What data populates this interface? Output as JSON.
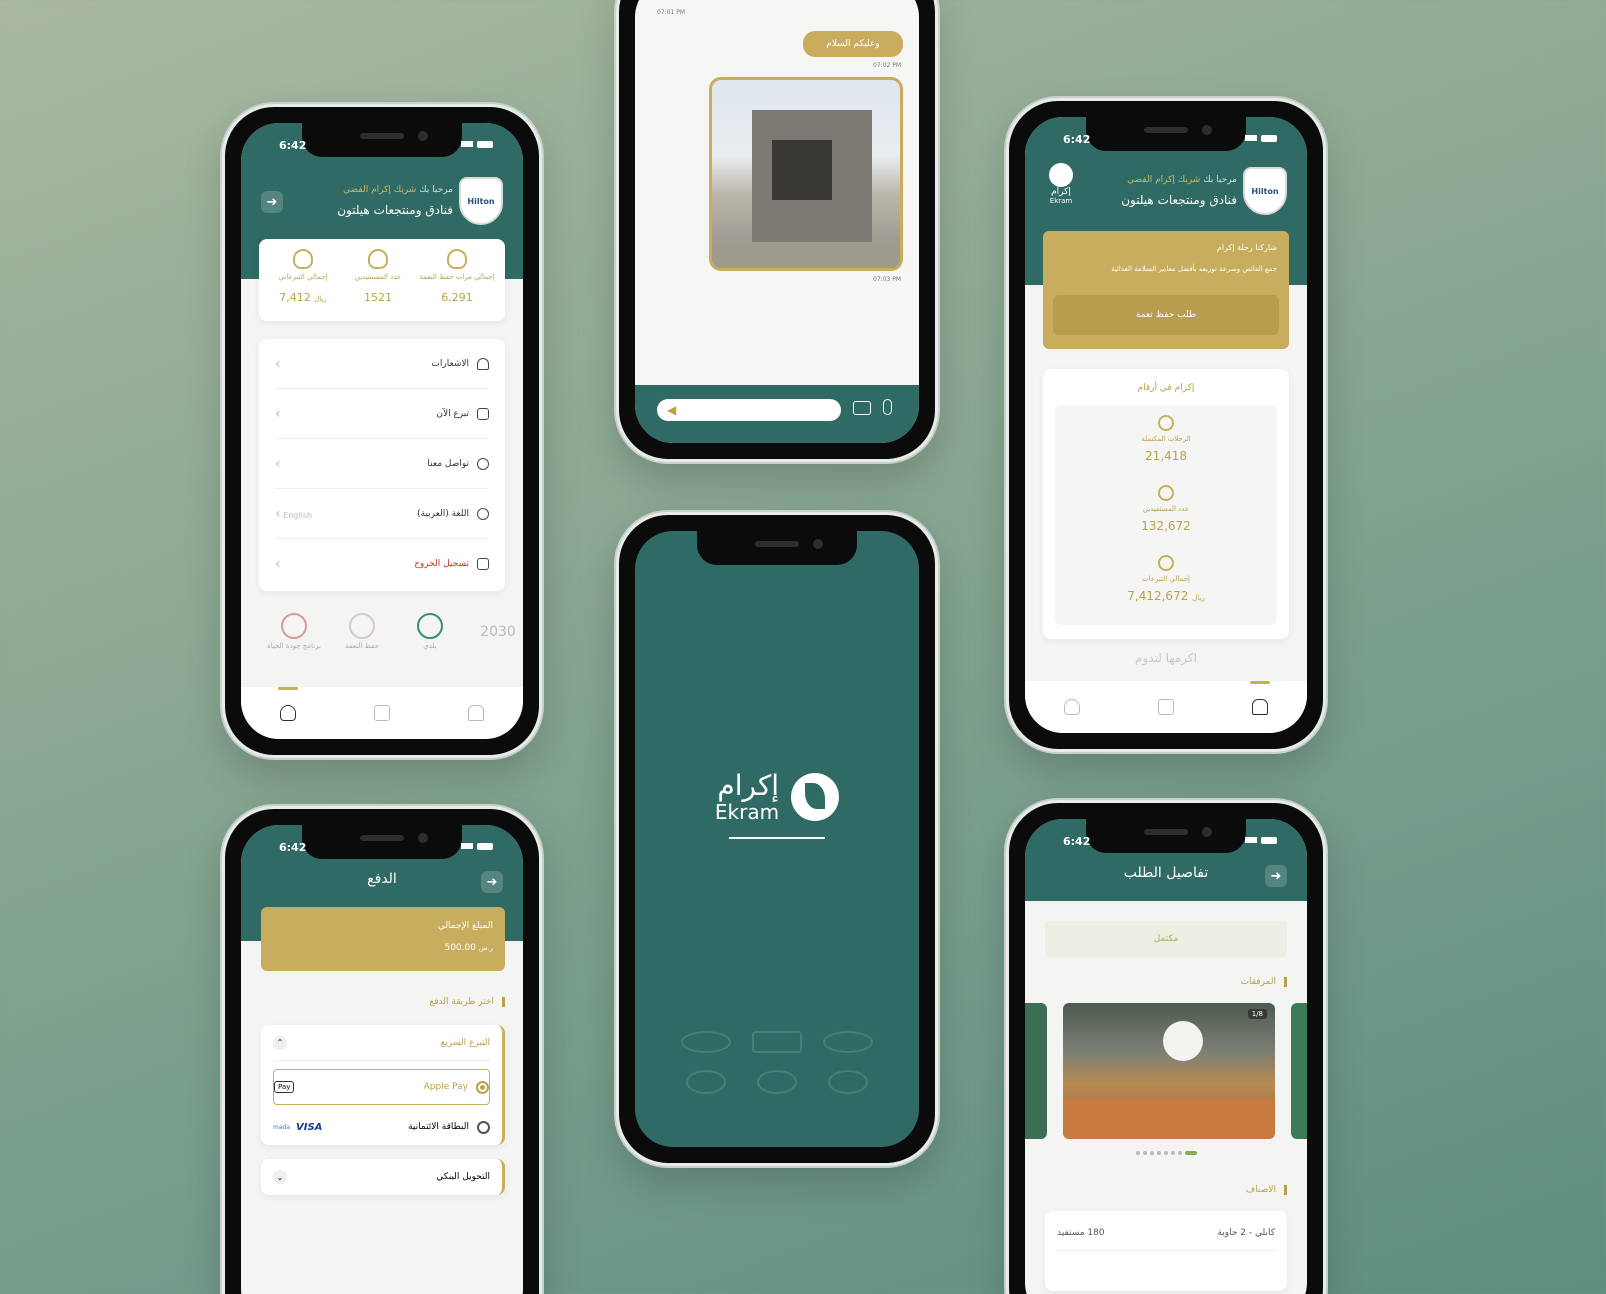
{
  "profile": {
    "time": "6:42",
    "welcome_prefix": "مرحبا بك",
    "partner_badge": "شريك إكرام الفضي",
    "org_name": "فنادق ومنتجعات هيلتون",
    "hilton_label": "Hilton",
    "stats": [
      {
        "label": "إجمالي التبرعاتي",
        "value": "7,412",
        "unit": "ريال"
      },
      {
        "label": "عدد المستفيدين",
        "value": "1521"
      },
      {
        "label": "إجمالي مرات حفظ النعمة",
        "value": "6,291"
      }
    ],
    "menu": [
      {
        "label": "الاشعارات",
        "icon": "bell-icon"
      },
      {
        "label": "تبرع الآن",
        "icon": "donate-icon"
      },
      {
        "label": "تواصل معنا",
        "icon": "headset-icon"
      },
      {
        "label": "اللغة (العربية)",
        "icon": "globe-icon",
        "side": "English"
      },
      {
        "label": "تسجيل الخروج",
        "icon": "logout-icon",
        "danger": true
      }
    ],
    "logos": [
      "برنامج جودة الحياة",
      "حفظ النعمة",
      "بلدي",
      "2030"
    ]
  },
  "chat": {
    "ts1": "07:01 PM",
    "message": "وعليكم السلام",
    "ts2": "07:02 PM",
    "ts3": "07:03 PM"
  },
  "home": {
    "time": "6:42",
    "welcome_prefix": "مرحبا بك",
    "partner_badge": "شريك إكرام الفضي",
    "org_name": "فنادق ومنتجعات هيلتون",
    "hilton_label": "Hilton",
    "logo_ar": "إكرام",
    "logo_en": "Ekram",
    "banner_title": "شاركنا رحلة إكرام",
    "banner_text": "جمع الفائض وسرعة توزيعه بأفضل معايير السلامة الغذائية",
    "banner_button": "طلب حفظ نعمة",
    "numbers_title": "إكرام في أرقام",
    "stats": [
      {
        "label": "الرحلات المكتملة",
        "value": "21,418"
      },
      {
        "label": "عدد المستفيدين",
        "value": "132,672"
      },
      {
        "label": "إجمالي التبرعات",
        "value": "7,412,672",
        "unit": "ريال"
      }
    ],
    "slogan": "اكرمها لتدوم"
  },
  "splash": {
    "logo_ar": "إكرام",
    "logo_en": "Ekram"
  },
  "payment": {
    "time": "6:42",
    "title": "الدفع",
    "total_label": "المبلغ الإجمالي",
    "total_value": "500.00",
    "currency": "ر.س",
    "choose_method": "اختر طريقة الدفع",
    "quick_donation": "التبرع السريع",
    "apple_pay": "Apple Pay",
    "apple_pay_badge": "Pay",
    "card_label": "البطاقة الائتمانية",
    "visa": "VISA",
    "mada": "mada",
    "bank_transfer": "التحويل البنكي"
  },
  "details": {
    "time": "6:42",
    "title": "تفاصيل الطلب",
    "status": "مكتمل",
    "attachments": "المرفقات",
    "counter": "1/8",
    "items_title": "الاصناف",
    "rows": [
      {
        "name": "كابلي - 2 حاوية",
        "count": "180 مستفيد"
      }
    ]
  },
  "colors": {
    "teal": "#2f6b64",
    "gold": "#c5b15c"
  }
}
